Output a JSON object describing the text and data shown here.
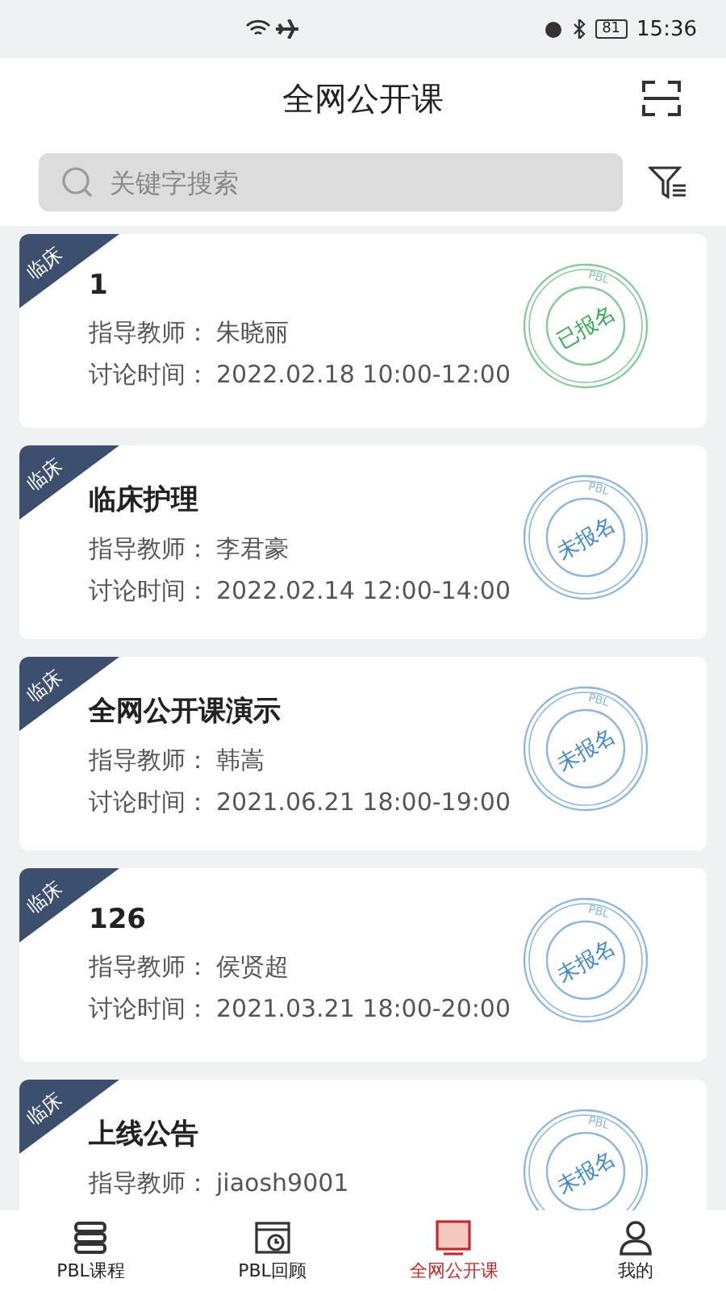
{
  "status_bar": {
    "time": "15:36",
    "battery": "81"
  },
  "header": {
    "title": "全网公开课"
  },
  "search": {
    "placeholder": "关键字搜索"
  },
  "courses": [
    {
      "tag": "临床",
      "title": "1",
      "teacher_label": "指导教师：",
      "teacher": "朱晓丽",
      "time_label": "讨论时间：",
      "time": "2022.02.18  10:00-12:00",
      "stamp": {
        "kind": "registered",
        "ring": "PBL",
        "label": "已报名"
      }
    },
    {
      "tag": "临床",
      "title": "临床护理",
      "teacher_label": "指导教师：",
      "teacher": "李君豪",
      "time_label": "讨论时间：",
      "time": "2022.02.14  12:00-14:00",
      "stamp": {
        "kind": "unregistered",
        "ring": "PBL",
        "label": "未报名"
      }
    },
    {
      "tag": "临床",
      "title": "全网公开课演示",
      "teacher_label": "指导教师：",
      "teacher": "韩嵩",
      "time_label": "讨论时间：",
      "time": "2021.06.21  18:00-19:00",
      "stamp": {
        "kind": "unregistered",
        "ring": "PBL",
        "label": "未报名"
      }
    },
    {
      "tag": "临床",
      "title": "126",
      "teacher_label": "指导教师：",
      "teacher": "侯贤超",
      "time_label": "讨论时间：",
      "time": "2021.03.21  18:00-20:00",
      "stamp": {
        "kind": "unregistered",
        "ring": "PBL",
        "label": "未报名"
      }
    },
    {
      "tag": "临床",
      "title": "上线公告",
      "teacher_label": "指导教师：",
      "teacher": "jiaosh9001",
      "stamp": {
        "kind": "unregistered",
        "ring": "PBL",
        "label": "未报名"
      }
    }
  ],
  "nav": [
    {
      "label": "PBL课程",
      "selected": false
    },
    {
      "label": "PBL回顾",
      "selected": false
    },
    {
      "label": "全网公开课",
      "selected": true
    },
    {
      "label": "我的",
      "selected": false
    }
  ]
}
